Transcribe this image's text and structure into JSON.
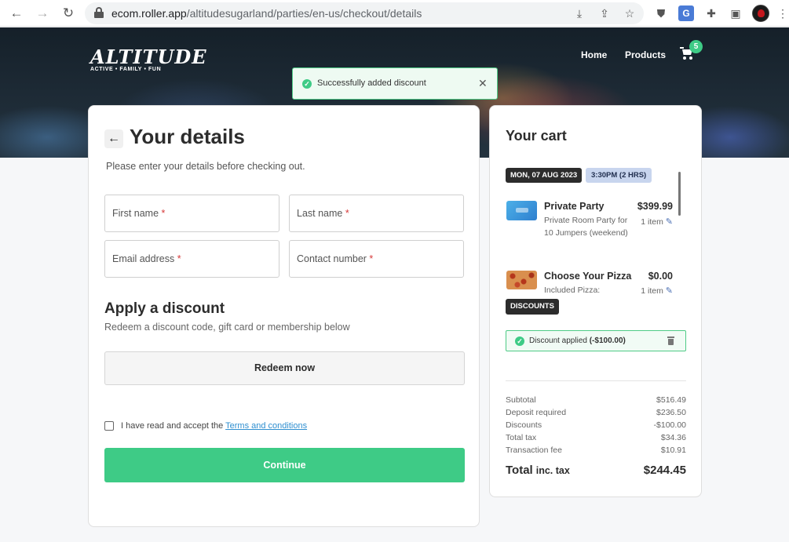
{
  "browser": {
    "url_host": "ecom.roller.app",
    "url_path": "/altitudesugarland/parties/en-us/checkout/details",
    "icons": [
      "back-arrow-icon",
      "forward-arrow-icon",
      "reload-icon",
      "lock-icon",
      "download-icon",
      "share-icon",
      "star-icon",
      "shield-icon",
      "translate-icon",
      "puzzle-icon",
      "sidebar-icon",
      "profile-avatar",
      "more-vert-icon"
    ],
    "translate_glyph": "G"
  },
  "header": {
    "logo_word": "ALTITUDE",
    "logo_tagline": "ACTIVE • FAMILY • FUN",
    "nav": [
      "Home",
      "Products"
    ],
    "cart_count": "5"
  },
  "toast": {
    "message": "Successfully added discount",
    "close": "✕"
  },
  "details": {
    "back": "←",
    "title": "Your details",
    "subtitle": "Please enter your details before checking out.",
    "fields": [
      {
        "label": "First name",
        "req": "*"
      },
      {
        "label": "Last name",
        "req": "*"
      },
      {
        "label": "Email address",
        "req": "*"
      },
      {
        "label": "Contact number",
        "req": "*"
      }
    ],
    "discount_title": "Apply a discount",
    "discount_sub": "Redeem a discount code, gift card or membership below",
    "redeem_label": "Redeem now",
    "terms_prefix": "I have read and accept the",
    "terms_link": "Terms and conditions",
    "continue_label": "Continue"
  },
  "cart": {
    "title": "Your cart",
    "date": "MON, 07 AUG 2023",
    "time": "3:30PM (2 HRS)",
    "items": [
      {
        "name": "Private Party",
        "desc": "Private Room Party for 10 Jumpers (weekend)",
        "price": "$399.99",
        "qty": "1 item"
      },
      {
        "name": "Choose Your Pizza",
        "desc": "Included Pizza:",
        "price": "$0.00",
        "qty": "1 item"
      }
    ],
    "discounts_label": "DISCOUNTS",
    "discount_applied": "Discount applied",
    "discount_amount": "(-$100.00)",
    "summary": [
      {
        "label": "Subtotal",
        "value": "$516.49"
      },
      {
        "label": "Deposit required",
        "value": "$236.50"
      },
      {
        "label": "Discounts",
        "value": "-$100.00"
      },
      {
        "label": "Total tax",
        "value": "$34.36"
      },
      {
        "label": "Transaction fee",
        "value": "$10.91"
      }
    ],
    "total_label": "Total",
    "total_inc": "inc. tax",
    "total_value": "$244.45"
  },
  "colors": {
    "accent_green": "#3ecb86",
    "dark": "#2c2c2c",
    "link_blue": "#2f8fd0",
    "required_red": "#d63a3a"
  }
}
